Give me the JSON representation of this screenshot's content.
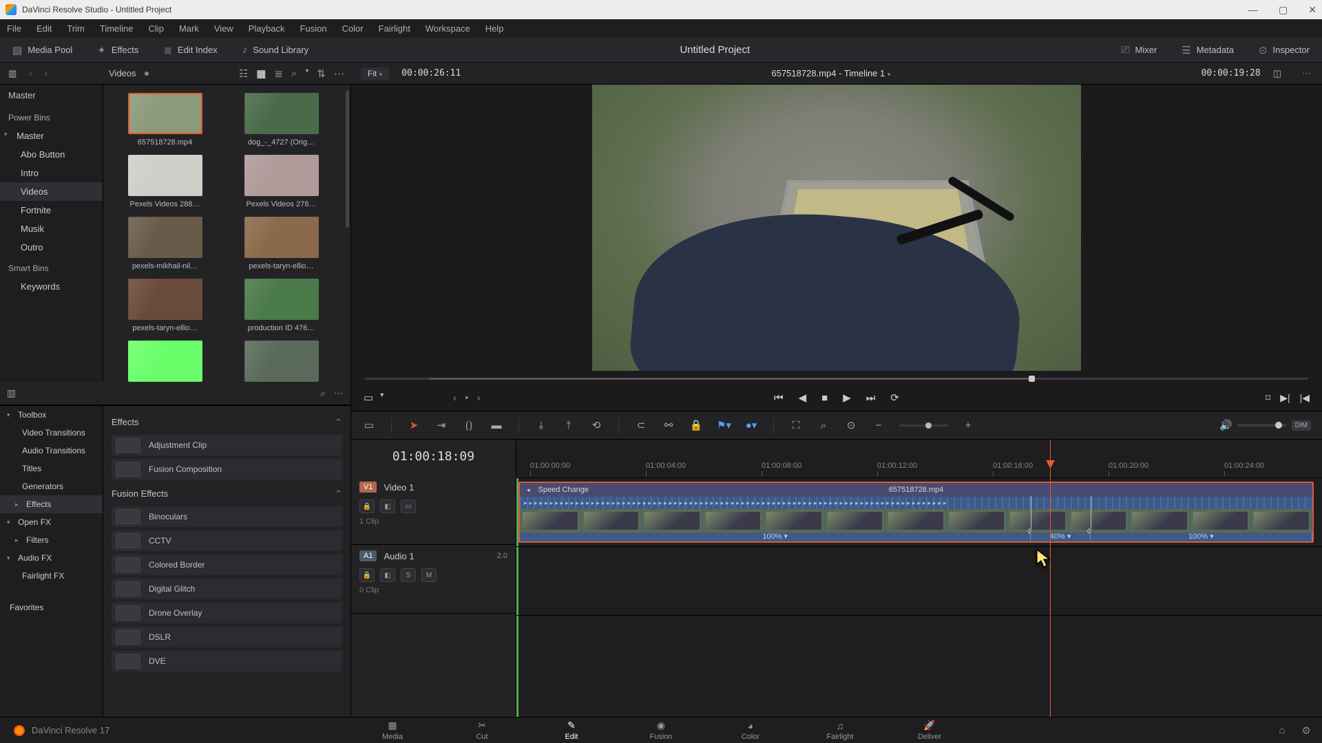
{
  "window": {
    "title": "DaVinci Resolve Studio - Untitled Project"
  },
  "menu": [
    "File",
    "Edit",
    "Trim",
    "Timeline",
    "Clip",
    "Mark",
    "View",
    "Playback",
    "Fusion",
    "Color",
    "Fairlight",
    "Workspace",
    "Help"
  ],
  "topbar": {
    "media_pool": "Media Pool",
    "effects": "Effects",
    "edit_index": "Edit Index",
    "sound_library": "Sound Library",
    "project": "Untitled Project",
    "mixer": "Mixer",
    "metadata": "Metadata",
    "inspector": "Inspector"
  },
  "secbar": {
    "crumb": "Videos",
    "fit": "Fit",
    "src_tc": "00:00:26:11",
    "timeline_title": "657518728.mp4 - Timeline 1",
    "right_tc": "00:00:19:28"
  },
  "tree": {
    "master": "Master",
    "powerbins": "Power Bins",
    "pb_items": [
      "Master",
      "Abo Button",
      "Intro",
      "Videos",
      "Fortnite",
      "Musik",
      "Outro"
    ],
    "smartbins": "Smart Bins",
    "sb_items": [
      "Keywords"
    ]
  },
  "thumbs": [
    {
      "name": "657518728.mp4",
      "sel": true,
      "bg": "#8a9a7a"
    },
    {
      "name": "dog_-_4727 (Orig…",
      "bg": "#4a6a4a"
    },
    {
      "name": "Pexels Videos 288…",
      "bg": "#cfcfca"
    },
    {
      "name": "Pexels Videos 278…",
      "bg": "#b09a9a"
    },
    {
      "name": "pexels-mikhail-nil…",
      "bg": "#6a5a4a"
    },
    {
      "name": "pexels-taryn-ellio…",
      "bg": "#8a6a4a"
    },
    {
      "name": "pexels-taryn-ellio…",
      "bg": "#6a4a3a"
    },
    {
      "name": "production ID 476…",
      "bg": "#4a7a4a"
    },
    {
      "name": "",
      "bg": "#6aff6a"
    },
    {
      "name": "",
      "bg": "#5a6a5a"
    }
  ],
  "fxtree": {
    "toolbox": "Toolbox",
    "video_trans": "Video Transitions",
    "audio_trans": "Audio Transitions",
    "titles": "Titles",
    "generators": "Generators",
    "effects": "Effects",
    "openfx": "Open FX",
    "filters": "Filters",
    "audiofx": "Audio FX",
    "fairlightfx": "Fairlight FX",
    "favorites": "Favorites"
  },
  "fxlist": {
    "hdr1": "Effects",
    "hdr2": "Fusion Effects",
    "g1": [
      "Adjustment Clip",
      "Fusion Composition"
    ],
    "g2": [
      "Binoculars",
      "CCTV",
      "Colored Border",
      "Digital Glitch",
      "Drone Overlay",
      "DSLR",
      "DVE"
    ]
  },
  "timeline": {
    "tc": "01:00:18:09",
    "v1": {
      "tag": "V1",
      "name": "Video 1",
      "clips": "1 Clip"
    },
    "a1": {
      "tag": "A1",
      "name": "Audio 1",
      "ch": "2.0",
      "clips": "0 Clip"
    },
    "clip": {
      "label": "Speed Change",
      "name": "657518728.mp4"
    },
    "marks": [
      "01:00:00:00",
      "01:00:04:00",
      "01:00:08:00",
      "01:00:12:00",
      "01:00:16:00",
      "01:00:20:00",
      "01:00:24:00"
    ],
    "speeds": [
      {
        "pct": "100%",
        "width": "64.5%"
      },
      {
        "pct": "40%",
        "width": "7.5%"
      },
      {
        "pct": "100%",
        "width": "28%"
      }
    ],
    "dim": "DIM"
  },
  "pages": [
    "Media",
    "Cut",
    "Edit",
    "Fusion",
    "Color",
    "Fairlight",
    "Deliver"
  ],
  "brand": "DaVinci Resolve 17"
}
